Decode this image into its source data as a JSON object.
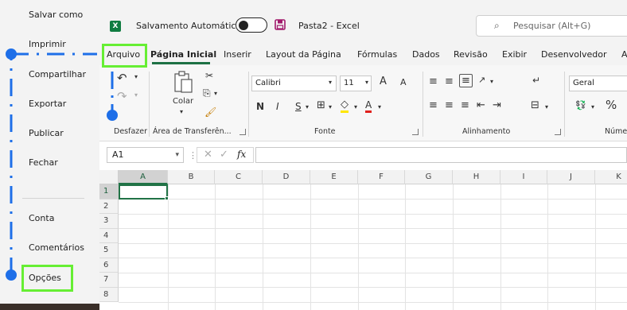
{
  "backstage": {
    "items": [
      "Salvar como",
      "Imprimir",
      "Compartilhar",
      "Exportar",
      "Publicar",
      "Fechar",
      "Conta",
      "Comentários",
      "Opções"
    ]
  },
  "titlebar": {
    "logo": "X",
    "autosave_label": "Salvamento Automático",
    "autosave_on": false,
    "doc_title": "Pasta2  -  Excel",
    "search_placeholder": "Pesquisar (Alt+G)"
  },
  "tabs": [
    "Arquivo",
    "Página Inicial",
    "Inserir",
    "Layout da Página",
    "Fórmulas",
    "Dados",
    "Revisão",
    "Exibir",
    "Desenvolvedor",
    "A"
  ],
  "active_tab": "Página Inicial",
  "ribbon": {
    "groups": [
      "Desfazer",
      "Área de Transferên...",
      "Fonte",
      "Alinhamento",
      "Núme"
    ],
    "paste_label": "Colar",
    "font_name": "Calibri",
    "font_size": "11",
    "number_format": "Geral",
    "font_buttons": [
      "N",
      "I",
      "S"
    ],
    "grow_font": "A",
    "shrink_font": "A",
    "font_color": "A",
    "percent": "%"
  },
  "formula_bar": {
    "name_box": "A1",
    "fx": "fx",
    "content": ""
  },
  "grid": {
    "columns": [
      "A",
      "B",
      "C",
      "D",
      "E",
      "F",
      "G",
      "H",
      "I",
      "J",
      "K"
    ],
    "rows": [
      "1",
      "2",
      "3",
      "4",
      "5",
      "6",
      "7",
      "8"
    ],
    "active_cell": "A1"
  },
  "colors": {
    "excel_green": "#217346",
    "highlight": "#66ee33",
    "arrow_blue": "#1e6fe8",
    "backstage_bg": "#f3f3f3"
  }
}
